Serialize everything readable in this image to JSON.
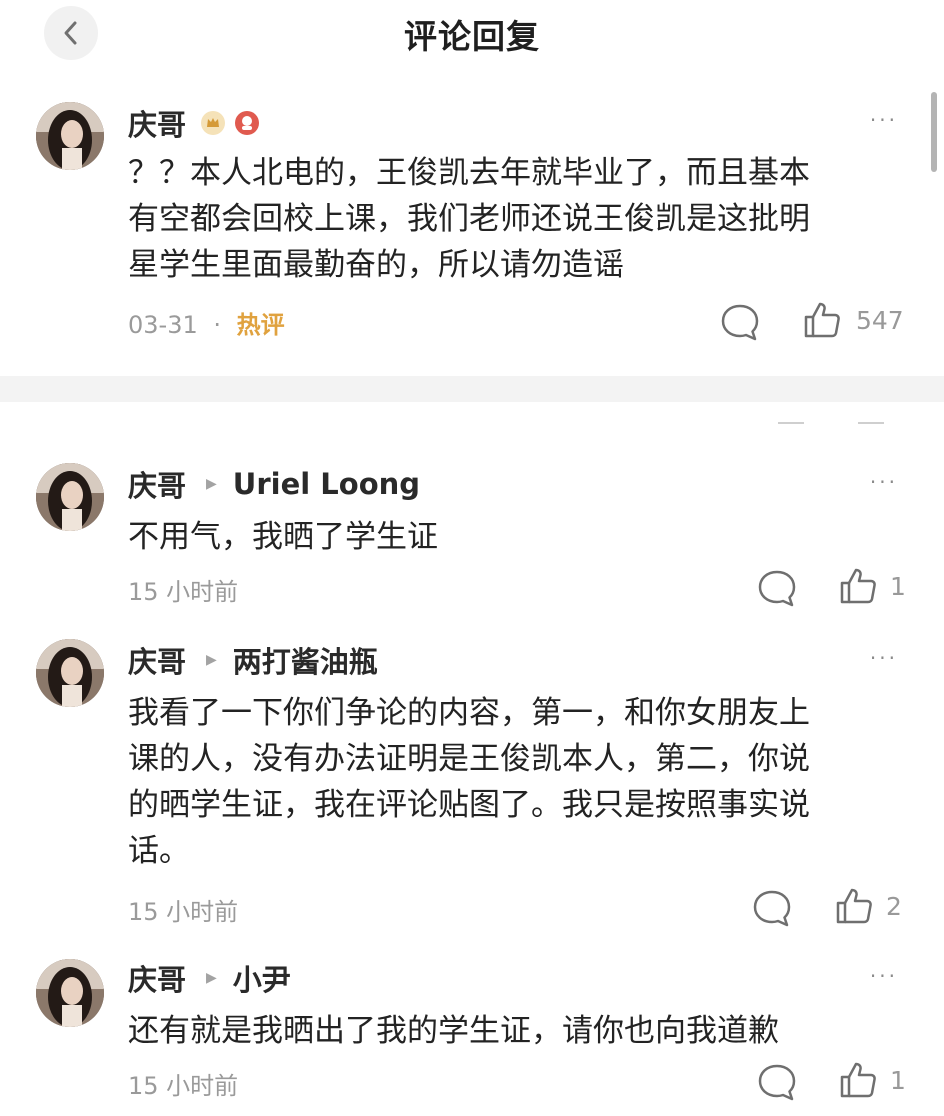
{
  "header": {
    "title": "评论回复",
    "back_icon": "chevron-left-icon"
  },
  "main_comment": {
    "author": "庆哥",
    "badges": [
      "crown-badge-icon",
      "vip-badge-icon"
    ],
    "text_lines": [
      "？？本人北电的，王俊凯去年就毕业了，而且基本",
      "有空都会回校上课，我们老师还说王俊凯是这批明",
      "星学生里面最勤奋的，所以请勿造谣"
    ],
    "date": "03-31",
    "separator": "·",
    "tag": "热评",
    "likes": "547"
  },
  "replies": [
    {
      "author": "庆哥",
      "reply_to": "Uriel Loong",
      "text_lines": [
        "不用气，我晒了学生证"
      ],
      "time": "15 小时前",
      "likes": "1"
    },
    {
      "author": "庆哥",
      "reply_to": "两打酱油瓶",
      "text_lines": [
        "我看了一下你们争论的内容，第一，和你女朋友上",
        "课的人，没有办法证明是王俊凯本人，第二，你说",
        "的晒学生证，我在评论贴图了。我只是按照事实说",
        "话。"
      ],
      "time": "15 小时前",
      "likes": "2"
    },
    {
      "author": "庆哥",
      "reply_to": "小尹",
      "text_lines": [
        "还有就是我晒出了我的学生证，请你也向我道歉"
      ],
      "time": "15 小时前",
      "likes": "1"
    }
  ],
  "more_label": "···",
  "arrow_glyph": "▶",
  "colors": {
    "hot_tag": "#e0a23f",
    "meta": "#9a9a9a",
    "divider": "#f3f3f3"
  }
}
